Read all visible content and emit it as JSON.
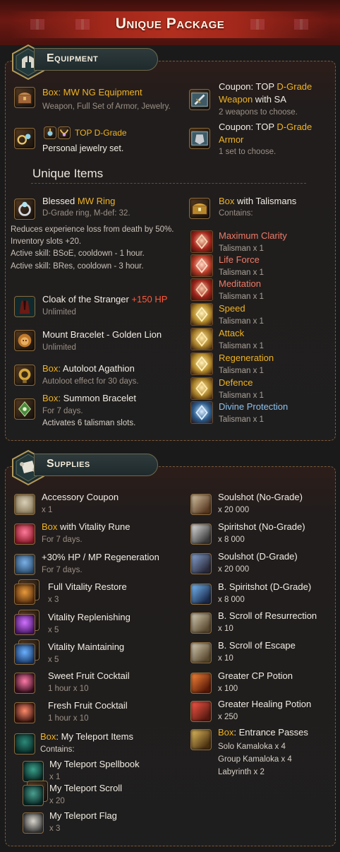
{
  "header": {
    "title": "Unique Package"
  },
  "colors": {
    "gold": "#f0b323",
    "red": "#ff5a3a",
    "accent_red": "#a3281b",
    "blue": "#8ec3ee",
    "pink": "#f07a66"
  },
  "equipment": {
    "title": "Equipment",
    "box_ng": {
      "prefix": "Box: ",
      "name": "MW NG Equipment",
      "sub": "Weapon, Full Set of Armor, Jewelry."
    },
    "top_d": {
      "name": "TOP D-Grade",
      "sub": "Personal jewelry set."
    },
    "coupon_weapon": {
      "prefix": "Coupon: TOP ",
      "grade": "D-Grade",
      "line2_gold": "Weapon",
      "line2_rest": " with SA",
      "sub": "2 weapons to choose."
    },
    "coupon_armor": {
      "prefix": "Coupon: TOP ",
      "grade": "D-Grade",
      "line2_gold": "Armor",
      "sub": "1 set to choose."
    },
    "unique_title": "Unique Items",
    "ring": {
      "prefix": "Blessed ",
      "name": "MW Ring",
      "sub": "D-Grade ring, M-def: 32.",
      "desc": [
        "Reduces experience loss from death by 50%.",
        "Inventory slots +20.",
        "Active skill: BSoE, cooldown - 1 hour.",
        "Active skill: BRes, cooldown - 3 hour."
      ]
    },
    "cloak": {
      "name": "Cloak of the Stranger ",
      "bonus": "+150 HP",
      "sub": "Unlimited"
    },
    "mount": {
      "name": "Mount Bracelet - Golden Lion",
      "sub": "Unlimited"
    },
    "agathion": {
      "prefix": "Box: ",
      "name": "Autoloot Agathion",
      "sub": "Autoloot effect for 30 days."
    },
    "bracelet": {
      "prefix": "Box: ",
      "name": "Summon Bracelet",
      "sub": "For 7 days.",
      "sub2": "Activates 6 talisman slots."
    },
    "talisman_box": {
      "prefix": "Box",
      "name": " with Talismans",
      "sub": "Contains:"
    },
    "talismans": [
      {
        "name": "Maximum Clarity",
        "qty": "Talisman x 1",
        "color": "#f07a66"
      },
      {
        "name": "Life Force",
        "qty": "Talisman x 1",
        "color": "#f07a66"
      },
      {
        "name": "Meditation",
        "qty": "Talisman x 1",
        "color": "#f07a66"
      },
      {
        "name": "Speed",
        "qty": "Talisman x 1",
        "color": "#f0b323"
      },
      {
        "name": "Attack",
        "qty": "Talisman x 1",
        "color": "#f0b323"
      },
      {
        "name": "Regeneration",
        "qty": "Talisman x 1",
        "color": "#f0b323"
      },
      {
        "name": "Defence",
        "qty": "Talisman x 1",
        "color": "#f0b323"
      },
      {
        "name": "Divine Protection",
        "qty": "Talisman x 1",
        "color": "#8ec3ee"
      }
    ]
  },
  "supplies": {
    "title": "Supplies",
    "left": [
      {
        "name": "Accessory Coupon",
        "sub": "x 1"
      },
      {
        "prefix": "Box",
        "name": " with Vitality Rune",
        "sub": "For 7 days."
      },
      {
        "name": "+30% HP / MP Regeneration",
        "sub": "For 7 days."
      },
      {
        "name": "Full Vitality Restore",
        "sub": "x 3"
      },
      {
        "name": "Vitality Replenishing",
        "sub": "x 5"
      },
      {
        "name": "Vitality Maintaining",
        "sub": "x 5"
      },
      {
        "name": "Sweet Fruit Cocktail",
        "sub": "1 hour x 10"
      },
      {
        "name": "Fresh Fruit Cocktail",
        "sub": "1 hour x 10"
      },
      {
        "prefix": "Box",
        "name": ": My Teleport Items",
        "sub": "Contains:"
      },
      {
        "name": "My Teleport Spellbook",
        "sub": "x 1"
      },
      {
        "name": "My Teleport Scroll",
        "sub": "x 20"
      },
      {
        "name": "My Teleport Flag",
        "sub": "x 3"
      }
    ],
    "right": [
      {
        "name": "Soulshot (No-Grade)",
        "sub": "x 20 000"
      },
      {
        "name": "Spiritshot (No-Grade)",
        "sub": "x 8 000"
      },
      {
        "name": "Soulshot (D-Grade)",
        "sub": "x 20 000"
      },
      {
        "name": "B. Spiritshot (D-Grade)",
        "sub": "x 8 000"
      },
      {
        "name": "B. Scroll of Resurrection",
        "sub": "x 10"
      },
      {
        "name": "B. Scroll of Escape",
        "sub": "x 10"
      },
      {
        "name": "Greater CP Potion",
        "sub": "x 100"
      },
      {
        "name": "Greater Healing Potion",
        "sub": "x 250"
      },
      {
        "prefix": "Box",
        "name": ": Entrance Passes",
        "subs": [
          "Solo Kamaloka x 4",
          "Group Kamaloka x 4",
          "Labyrinth x 2"
        ]
      }
    ]
  },
  "icons": [
    "helmet-icon",
    "scroll-icon",
    "chest-icon",
    "ring-icon",
    "cloak-icon",
    "lion-icon",
    "agathion-icon",
    "bracelet-icon",
    "coupon-icon",
    "potion-icon",
    "shot-icon",
    "talisman-icon"
  ]
}
